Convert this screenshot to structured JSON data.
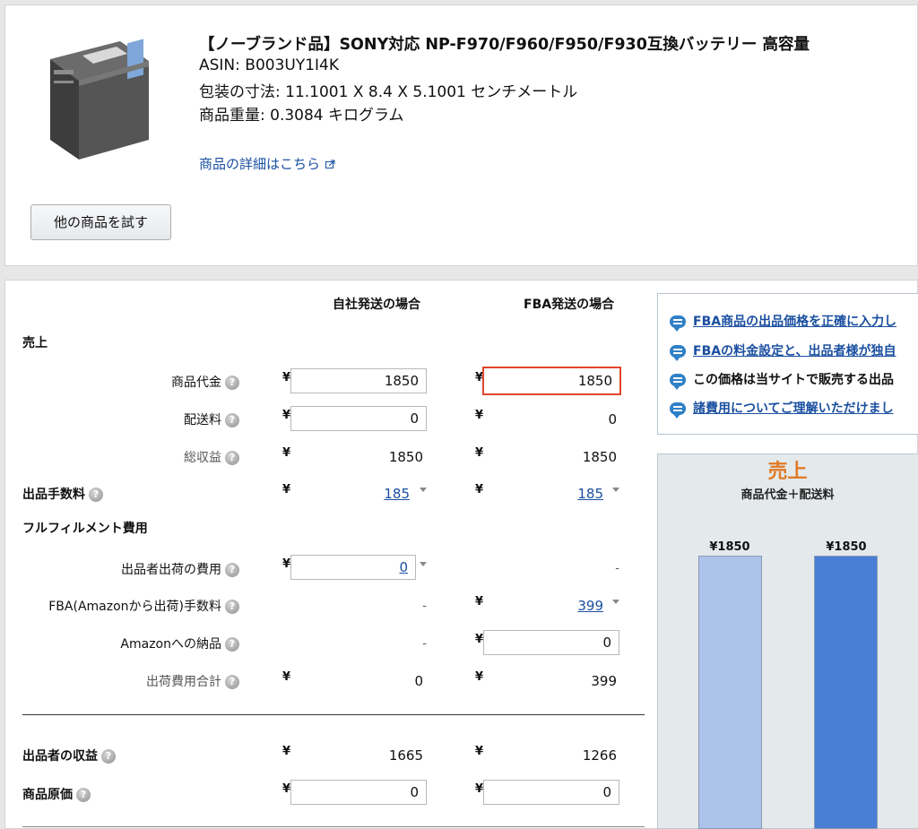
{
  "product": {
    "title": "【ノーブランド品】SONY対応 NP-F970/F960/F950/F930互換バッテリー 高容量",
    "asin": "ASIN: B003UY1I4K",
    "dimensions": "包装の寸法: 11.1001 X 8.4 X 5.1001 センチメートル",
    "weight": "商品重量: 0.3084 キログラム",
    "details_link": "商品の詳細はこちら",
    "try_other_button": "他の商品を試す"
  },
  "columns": {
    "self": "自社発送の場合",
    "fba": "FBA発送の場合"
  },
  "currency": "¥",
  "sections": {
    "sales": "売上",
    "fulfillment": "フルフィルメント費用"
  },
  "rows": {
    "item_price": {
      "label": "商品代金",
      "self": "1850",
      "fba": "1850"
    },
    "shipping": {
      "label": "配送料",
      "self": "0",
      "fba": "0"
    },
    "total_revenue": {
      "label": "総収益",
      "self": "1850",
      "fba": "1850"
    },
    "selling_fee": {
      "label": "出品手数料",
      "self": "185",
      "fba": "185"
    },
    "seller_shipping_cost": {
      "label": "出品者出荷の費用",
      "self": "0",
      "fba": "-"
    },
    "fba_fee": {
      "label": "FBA(Amazonから出荷)手数料",
      "self": "-",
      "fba": "399"
    },
    "inbound_to_amazon": {
      "label": "Amazonへの納品",
      "self": "-",
      "fba": "0"
    },
    "shipping_total": {
      "label": "出荷費用合計",
      "self": "0",
      "fba": "399"
    },
    "seller_proceeds": {
      "label": "出品者の収益",
      "self": "1665",
      "fba": "1266"
    },
    "cost_of_goods": {
      "label": "商品原価",
      "self": "0",
      "fba": "0"
    }
  },
  "tips": [
    "FBA商品の出品価格を正確に入力し",
    "FBAの料金設定と、出品者様が独自",
    "この価格は当サイトで販売する出品",
    "諸費用についてご理解いただけまし"
  ],
  "chart": {
    "title": "売上",
    "subtitle": "商品代金＋配送料",
    "bar1_label": "¥1850",
    "bar2_label": "¥1850"
  },
  "chart_data": {
    "type": "bar",
    "title": "売上",
    "subtitle": "商品代金＋配送料",
    "categories": [
      "自社発送の場合",
      "FBA発送の場合"
    ],
    "values": [
      1850,
      1850
    ],
    "data_labels": [
      "¥1850",
      "¥1850"
    ],
    "colors": [
      "#aec3ea",
      "#4a7fd6"
    ]
  },
  "colors": {
    "accent_orange": "#e07a26",
    "link_blue": "#1a4fa0",
    "highlight_red": "#e1452d",
    "bar_light": "#aec3ea",
    "bar_dark": "#4a7fd6"
  }
}
